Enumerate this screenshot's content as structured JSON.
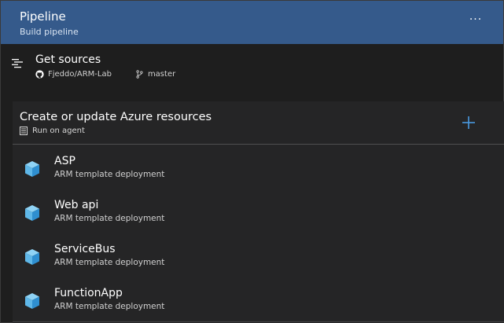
{
  "header": {
    "title": "Pipeline",
    "subtitle": "Build pipeline",
    "more_label": "···"
  },
  "get_sources": {
    "title": "Get sources",
    "repo": "Fjeddo/ARM-Lab",
    "branch": "master"
  },
  "job": {
    "title": "Create or update Azure resources",
    "subtitle": "Run on agent"
  },
  "tasks": [
    {
      "name": "ASP",
      "desc": "ARM template deployment"
    },
    {
      "name": "Web api",
      "desc": "ARM template deployment"
    },
    {
      "name": "ServiceBus",
      "desc": "ARM template deployment"
    },
    {
      "name": "FunctionApp",
      "desc": "ARM template deployment"
    }
  ],
  "colors": {
    "header_bg": "#355a8b",
    "accent": "#4a9ae0",
    "cube": "#5fb7e8"
  }
}
